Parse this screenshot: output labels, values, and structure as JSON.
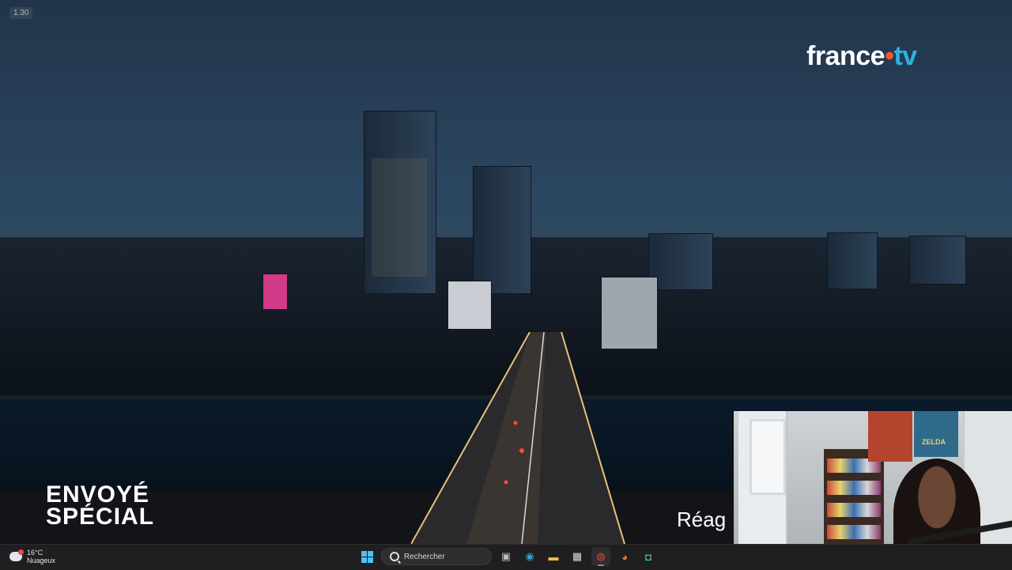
{
  "video": {
    "timestamp_badge": "1.30",
    "channel_logo": {
      "word": "france",
      "dot": "•",
      "suffix": "tv"
    },
    "show_logo": {
      "line1": "ENVOYÉ",
      "line2": "SPÉCIAL"
    },
    "caption_partial": "Réag"
  },
  "webcam": {
    "poster_text": "ZELDA"
  },
  "taskbar": {
    "weather": {
      "temperature": "16°C",
      "condition": "Nuageux"
    },
    "search": {
      "label": "Rechercher"
    },
    "apps": [
      {
        "name": "task-view",
        "glyph": "▣",
        "color": "#bdbdbd"
      },
      {
        "name": "edge",
        "glyph": "◉",
        "color": "#2fa3d9"
      },
      {
        "name": "file-explorer",
        "glyph": "▬",
        "color": "#f3c13a"
      },
      {
        "name": "store",
        "glyph": "▦",
        "color": "#dedede"
      },
      {
        "name": "chrome",
        "glyph": "◍",
        "color": "#e2483b"
      },
      {
        "name": "firefox",
        "glyph": "◕",
        "color": "#ff7a2a"
      },
      {
        "name": "discord",
        "glyph": "◘",
        "color": "#3ed598"
      }
    ]
  },
  "colors": {
    "accent_orange": "#f05a28",
    "accent_blue": "#2bb3e5"
  }
}
